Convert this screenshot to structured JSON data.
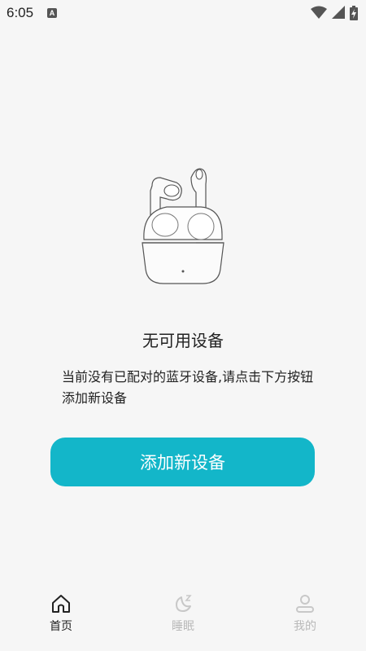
{
  "status_bar": {
    "time": "6:05",
    "notification_icon": "A",
    "icons": [
      "wifi-icon",
      "signal-icon",
      "battery-icon"
    ]
  },
  "empty_state": {
    "image_icon": "earbuds-case-illustration",
    "title": "无可用设备",
    "description": "当前没有已配对的蓝牙设备,请点击下方按钮添加新设备"
  },
  "primary_button": {
    "label": "添加新设备",
    "color": "#13b6c9"
  },
  "tab_bar": {
    "items": [
      {
        "label": "首页",
        "icon": "home-icon",
        "active": true
      },
      {
        "label": "睡眠",
        "icon": "sleep-moon-icon",
        "active": false
      },
      {
        "label": "我的",
        "icon": "profile-icon",
        "active": false
      }
    ]
  }
}
